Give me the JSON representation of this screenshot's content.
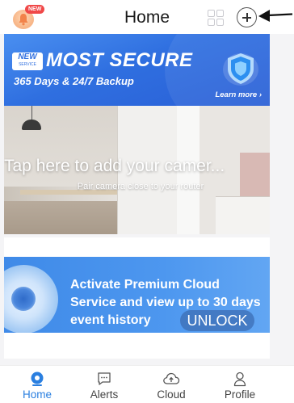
{
  "header": {
    "title": "Home",
    "bell_badge": "NEW",
    "icons": [
      "bell-icon",
      "grid-view-icon",
      "plus-icon",
      "arrow-left-icon"
    ]
  },
  "promo": {
    "new_tag": "NEW",
    "new_tag_sub": "SERVICE",
    "title": "MOST SECURE",
    "subtitle": "365 Days & 24/7 Backup",
    "link": "Learn more ›"
  },
  "camera_card": {
    "title": "Tap here to add your camer...",
    "subtitle": "Pair camera close to your router"
  },
  "cloud_card": {
    "text": "Activate Premium Cloud Service and view up to 30 days event history",
    "button": "UNLOCK"
  },
  "nav": {
    "items": [
      {
        "label": "Home",
        "icon": "home-camera-icon",
        "active": true
      },
      {
        "label": "Alerts",
        "icon": "alerts-chat-icon",
        "active": false
      },
      {
        "label": "Cloud",
        "icon": "cloud-upload-icon",
        "active": false
      },
      {
        "label": "Profile",
        "icon": "profile-icon",
        "active": false
      }
    ]
  },
  "colors": {
    "accent": "#2a7fe0",
    "promo_blue": "#2f6fe0",
    "badge_red": "#f04848"
  }
}
